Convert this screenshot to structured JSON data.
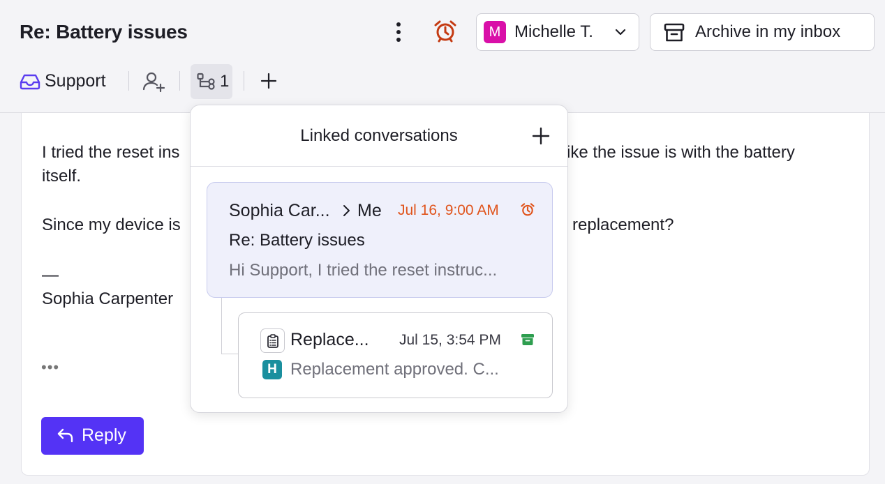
{
  "header": {
    "title": "Re: Battery issues",
    "assignee": {
      "initial": "M",
      "name": "Michelle T.",
      "avatar_color": "#d90fa8"
    },
    "archive_label": "Archive in my inbox",
    "inbox_label": "Support",
    "linked_count": "1"
  },
  "message": {
    "line1": "I tried the reset ins",
    "line1_right": "ike the issue is with the battery",
    "line2": "itself.",
    "line3": "Since my device is",
    "line3_right": "replacement?",
    "dash": "—",
    "signature": "Sophia Carpenter",
    "ellipsis": "•••",
    "reply_label": "Reply"
  },
  "linked_popover": {
    "title": "Linked conversations",
    "conversations": [
      {
        "from": "Sophia Car...",
        "to": "Me",
        "date": "Jul 16, 9:00 AM",
        "subject": "Re: Battery issues",
        "preview": "Hi Support, I tried the reset instruc..."
      },
      {
        "title": "Replace...",
        "date": "Jul 15, 3:54 PM",
        "author_initial": "H",
        "preview": "Replacement approved. C..."
      }
    ]
  },
  "colors": {
    "accent": "#5433f5",
    "alarm": "#e0541c",
    "archived_green": "#2e9e4f",
    "inbox_icon": "#5a3cf0"
  }
}
